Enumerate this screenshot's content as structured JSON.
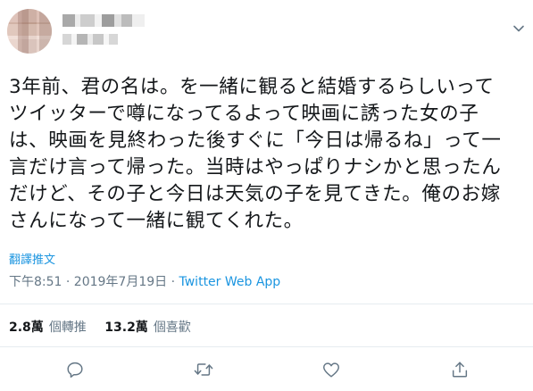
{
  "tweet": {
    "lines": [
      "3年前、君の名は。を一緒に観ると結婚するらしいって",
      "ツイッターで噂になってるよって映画に誘った女の子",
      "は、映画を見終わった後すぐに「今日は帰るね」って一",
      "言だけ言って帰った。当時はやっぱりナシかと思ったん",
      "だけど、その子と今日は天気の子を見てきた。俺のお嫁",
      "さんになって一緒に観てくれた。"
    ],
    "translate_label": "翻譯推文",
    "timestamp": "下午8:51 · 2019年7月19日 · ",
    "source": "Twitter Web App"
  },
  "stats": {
    "retweets_count": "2.8萬",
    "retweets_label": "個轉推",
    "likes_count": "13.2萬",
    "likes_label": "個喜歡"
  },
  "icons": {
    "caret": "chevron-down-icon",
    "reply": "reply-icon",
    "retweet": "retweet-icon",
    "like": "heart-icon",
    "share": "share-icon"
  },
  "colors": {
    "text": "#14171a",
    "secondary": "#657786",
    "link": "#1b95e0",
    "divider": "#e6ecf0"
  }
}
